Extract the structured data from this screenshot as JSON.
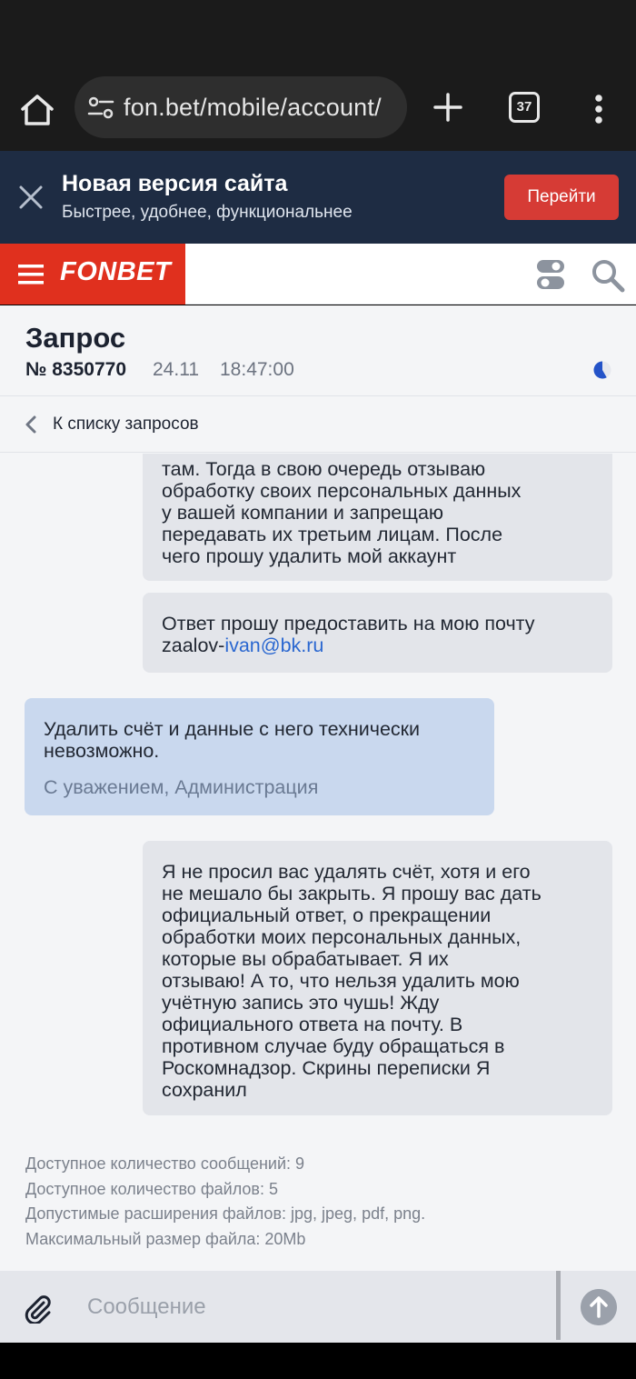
{
  "browser": {
    "url": "fon.bet/mobile/account/",
    "tab_count": "37"
  },
  "banner": {
    "title": "Новая версия сайта",
    "subtitle": "Быстрее, удобнее, функциональнее",
    "button_label": "Перейти"
  },
  "header": {
    "brand": "FONBET"
  },
  "request": {
    "title": "Запрос",
    "number": "№ 8350770",
    "date": "24.11",
    "time": "18:47:00",
    "back_label": "К списку запросов"
  },
  "messages": [
    {
      "author": "user",
      "text": "там. Тогда в свою очередь отзываю\nобработку своих персональных данных\nу вашей компании и запрещаю\nпередавать их третьим лицам. После\nчего прошу удалить мой аккаунт"
    },
    {
      "author": "user",
      "text_prefix": "Ответ прошу предоставить на мою почту\nzaalov-",
      "email": "ivan@bk.ru"
    },
    {
      "author": "admin",
      "text": "Удалить счёт и данные с него технически\nневозможно.",
      "signature": "С уважением, Администрация"
    },
    {
      "author": "user",
      "text": "Я не просил вас удалять счёт, хотя и его\nне мешало бы закрыть. Я прошу вас дать\nофициальный ответ, о прекращении\nобработки моих персональных данных,\nкоторые вы обрабатывает. Я их\nотзываю! А то, что нельзя удалить мою\nучётную запись это чушь! Жду\nофициального ответа на почту. В\nпротивном случае буду обращаться в\nРоскомнадзор. Скрины переписки Я\nсохранил"
    }
  ],
  "limits": [
    "Доступное количество сообщений: 9",
    "Доступное количество файлов: 5",
    "Допустимые расширения файлов: jpg, jpeg, pdf, png.",
    "Максимальный размер файла: 20Mb"
  ],
  "composer": {
    "placeholder": "Сообщение"
  },
  "colors": {
    "brand_red": "#e0301e",
    "banner_bg": "#1e2c43",
    "banner_button": "#d63b35",
    "user_bubble": "#e3e5ea",
    "admin_bubble": "#c9d8ee",
    "link": "#2a67d0"
  },
  "icons": [
    "home-icon",
    "site-settings-icon",
    "plus-icon",
    "tab-switcher-icon",
    "more-vert-icon",
    "close-icon",
    "menu-icon",
    "toggle-icon",
    "search-icon",
    "status-icon",
    "chevron-left-icon",
    "paperclip-icon",
    "arrow-up-icon"
  ]
}
